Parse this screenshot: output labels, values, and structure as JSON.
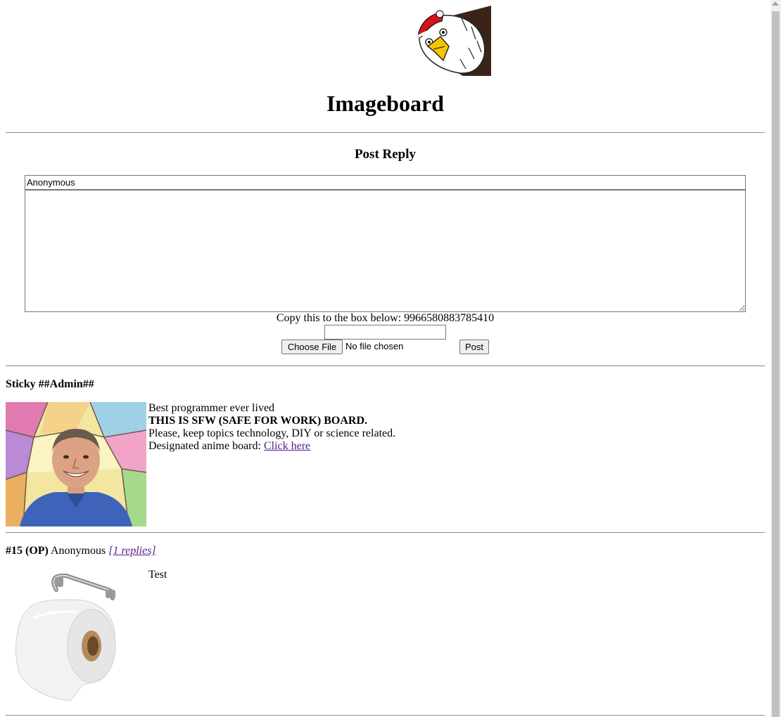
{
  "header": {
    "title": "Imageboard"
  },
  "reply_form": {
    "heading": "Post Reply",
    "name_value": "Anonymous",
    "message_value": "",
    "captcha_prompt": "Copy this to the box below: 9966580883785410",
    "captcha_value": "",
    "file_button_label": "Choose File",
    "file_status": "No file chosen",
    "submit_label": "Post"
  },
  "sticky": {
    "heading": "Sticky ##Admin##",
    "line1": "Best programmer ever lived",
    "line2": "THIS IS SFW (SAFE FOR WORK) BOARD.",
    "line3": "Please, keep topics technology, DIY or science related.",
    "line4_prefix": "Designated anime board: ",
    "line4_link": "Click here"
  },
  "threads": [
    {
      "number": "#15 (OP)",
      "author": "Anonymous",
      "replies_link": "[1 replies]",
      "text": "Test"
    }
  ]
}
